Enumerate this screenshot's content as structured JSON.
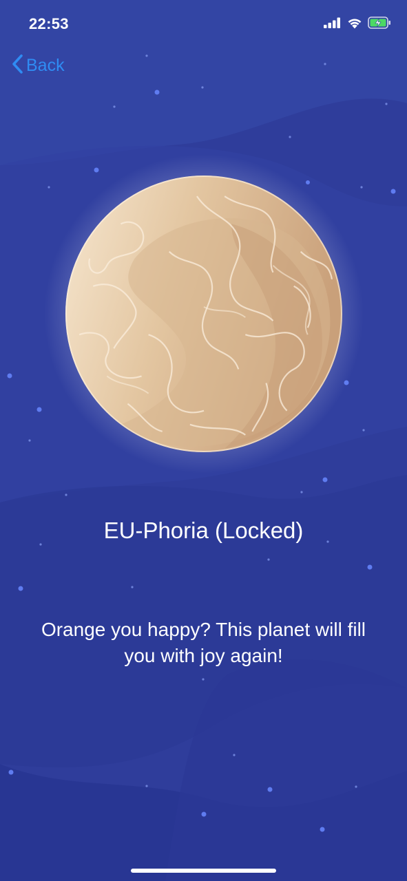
{
  "status_bar": {
    "time": "22:53",
    "icons": [
      "cellular-signal-icon",
      "wifi-icon",
      "battery-charging-icon"
    ]
  },
  "nav": {
    "back_label": "Back"
  },
  "planet": {
    "name": "EU-Phoria (Locked)",
    "description": "Orange you happy? This planet will fill you with joy again!",
    "icon": "planet-icon"
  },
  "colors": {
    "background": "#2f3e9c",
    "accent_link": "#2f8cf3",
    "planet_light": "#f1dcc0",
    "planet_dark": "#c9a37c"
  }
}
